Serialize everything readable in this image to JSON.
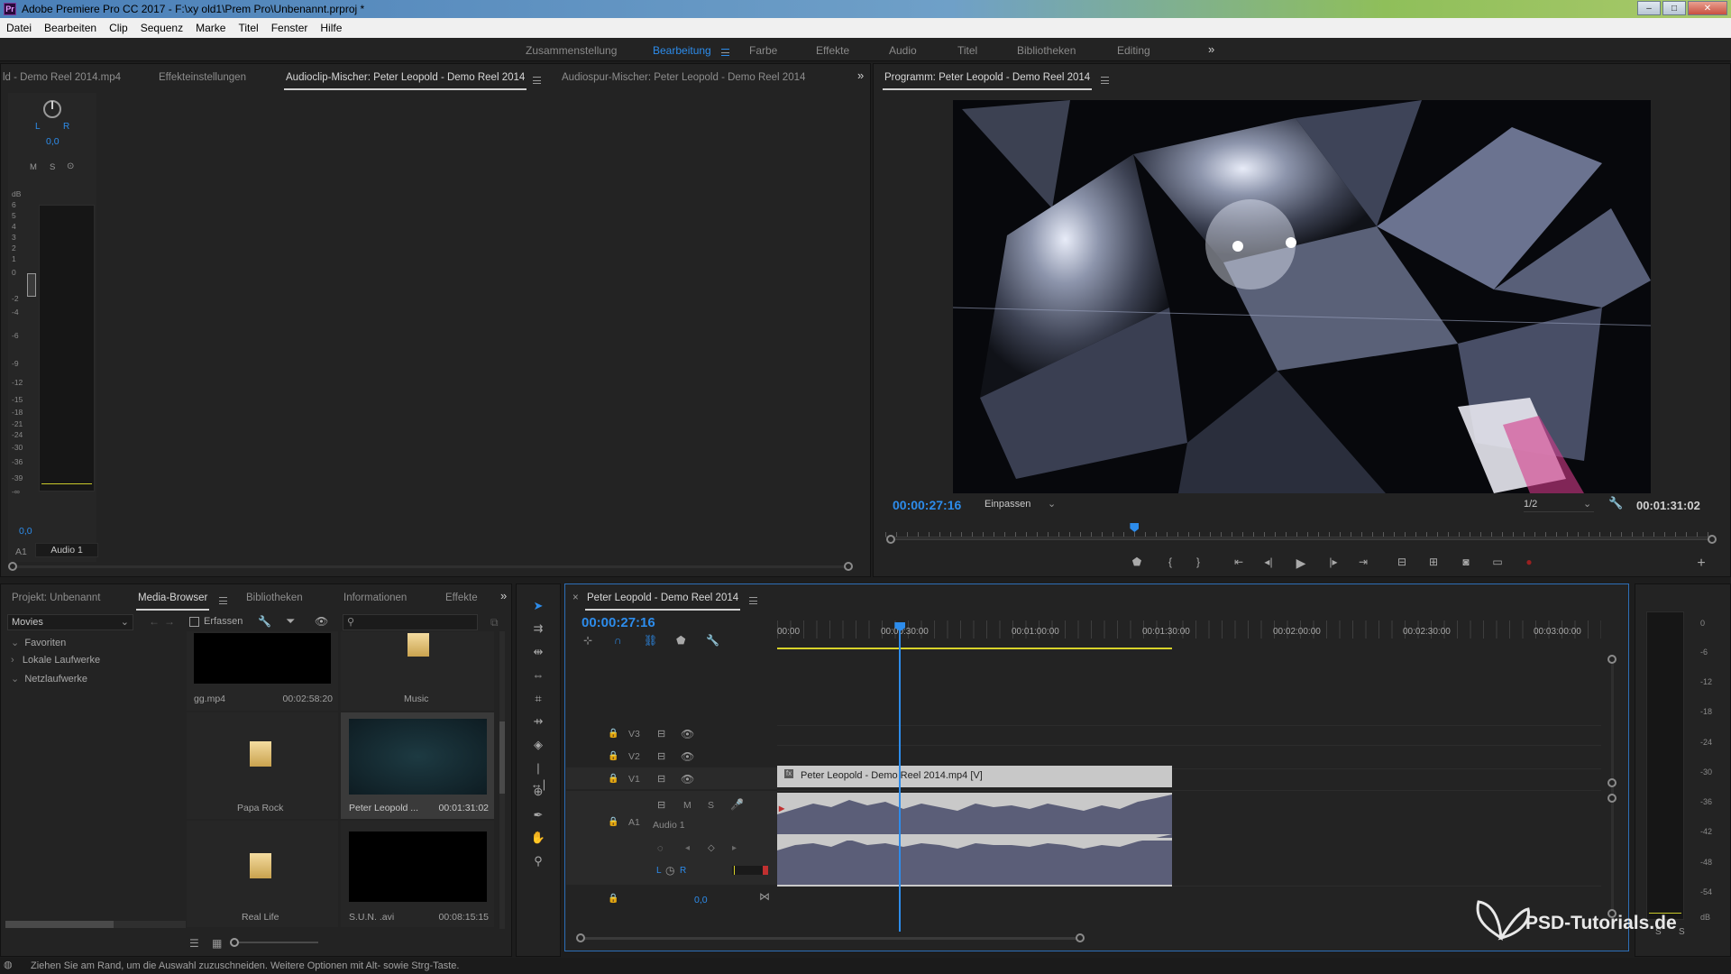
{
  "window": {
    "title": "Adobe Premiere Pro CC 2017 - F:\\xy old1\\Prem Pro\\Unbenannt.prproj *",
    "app_icon": "Pr",
    "controls": [
      "–",
      "□",
      "✕"
    ]
  },
  "menu": [
    "Datei",
    "Bearbeiten",
    "Clip",
    "Sequenz",
    "Marke",
    "Titel",
    "Fenster",
    "Hilfe"
  ],
  "workspaces": {
    "items": [
      "Zusammenstellung",
      "Bearbeitung",
      "Farbe",
      "Effekte",
      "Audio",
      "Titel",
      "Bibliotheken",
      "Editing"
    ],
    "active": "Bearbeitung",
    "overflow": "»"
  },
  "source_panel": {
    "tabs": [
      "ld - Demo Reel 2014.mp4",
      "Effekteinstellungen",
      "Audioclip-Mischer: Peter Leopold - Demo Reel 2014",
      "Audiospur-Mischer: Peter Leopold - Demo Reel 2014"
    ],
    "active_tab": "Audioclip-Mischer: Peter Leopold - Demo Reel 2014",
    "pan_l": "L",
    "pan_r": "R",
    "pan_value": "0,0",
    "buttons": [
      "M",
      "S",
      "⊙"
    ],
    "db_label": "dB",
    "scale": [
      "6",
      "5",
      "4",
      "3",
      "2",
      "1",
      "0",
      "-2",
      "-4",
      "-6",
      "-9",
      "-12",
      "-15",
      "-18",
      "-21",
      "-24",
      "-30",
      "-36",
      "-39",
      "-∞"
    ],
    "volume_value": "0,0",
    "channel_label": "A1",
    "track_name": "Audio 1"
  },
  "program_monitor": {
    "title": "Programm: Peter Leopold - Demo Reel 2014",
    "timecode": "00:00:27:16",
    "fit": "Einpassen",
    "resolution": "1/2",
    "duration": "00:01:31:02",
    "playhead_fraction": 0.3
  },
  "project_panel": {
    "tabs": [
      "Projekt: Unbenannt",
      "Media-Browser",
      "Bibliotheken",
      "Informationen",
      "Effekte"
    ],
    "active_tab": "Media-Browser",
    "location": "Movies",
    "ingest_label": "Erfassen",
    "tree": [
      "Favoriten",
      "Lokale Laufwerke",
      "Netzlaufwerke"
    ],
    "items": [
      {
        "name": "gg.mp4",
        "duration": "00:02:58:20",
        "kind": "video-dark"
      },
      {
        "name": "Music",
        "duration": "",
        "kind": "folder"
      },
      {
        "name": "Papa Rock",
        "duration": "",
        "kind": "folder"
      },
      {
        "name": "Peter Leopold ...",
        "duration": "00:01:31:02",
        "kind": "video-teal"
      },
      {
        "name": "Real Life",
        "duration": "",
        "kind": "folder"
      },
      {
        "name": "S.U.N. .avi",
        "duration": "00:08:15:15",
        "kind": "video-dark"
      }
    ]
  },
  "timeline": {
    "sequence_name": "Peter Leopold - Demo Reel 2014",
    "timecode": "00:00:27:16",
    "ruler": [
      "00:00",
      "00:00:30:00",
      "00:01:00:00",
      "00:01:30:00",
      "00:02:00:00",
      "00:02:30:00",
      "00:03:00:00"
    ],
    "tracks": {
      "v3": {
        "src": "",
        "tgt": "V3"
      },
      "v2": {
        "src": "",
        "tgt": "V2"
      },
      "v1": {
        "src": "V1",
        "tgt": "V1"
      },
      "a1": {
        "src": "A1",
        "tgt": "A1",
        "name": "Audio 1",
        "m": "M",
        "s": "S"
      },
      "pan_l": "L",
      "pan_r": "R",
      "master_value": "0,0"
    },
    "video_clip": "Peter Leopold - Demo Reel 2014.mp4 [V]",
    "playhead_fraction": 0.148
  },
  "right_meter": {
    "scale": [
      "0",
      "-6",
      "-12",
      "-18",
      "-24",
      "-30",
      "-36",
      "-42",
      "-48",
      "-54",
      "dB"
    ],
    "bottom": [
      "S",
      "S"
    ]
  },
  "status_bar": {
    "text": "Ziehen Sie am Rand, um die Auswahl zuzuschneiden. Weitere Optionen mit Alt- sowie Strg-Taste."
  },
  "watermark": {
    "text": "PSD-Tutorials.de"
  },
  "colors": {
    "accent": "#2d8ceb",
    "panel": "#232323",
    "background": "#1d1d1d",
    "work_area": "#d8d22a",
    "playhead": "#2d8ceb"
  }
}
